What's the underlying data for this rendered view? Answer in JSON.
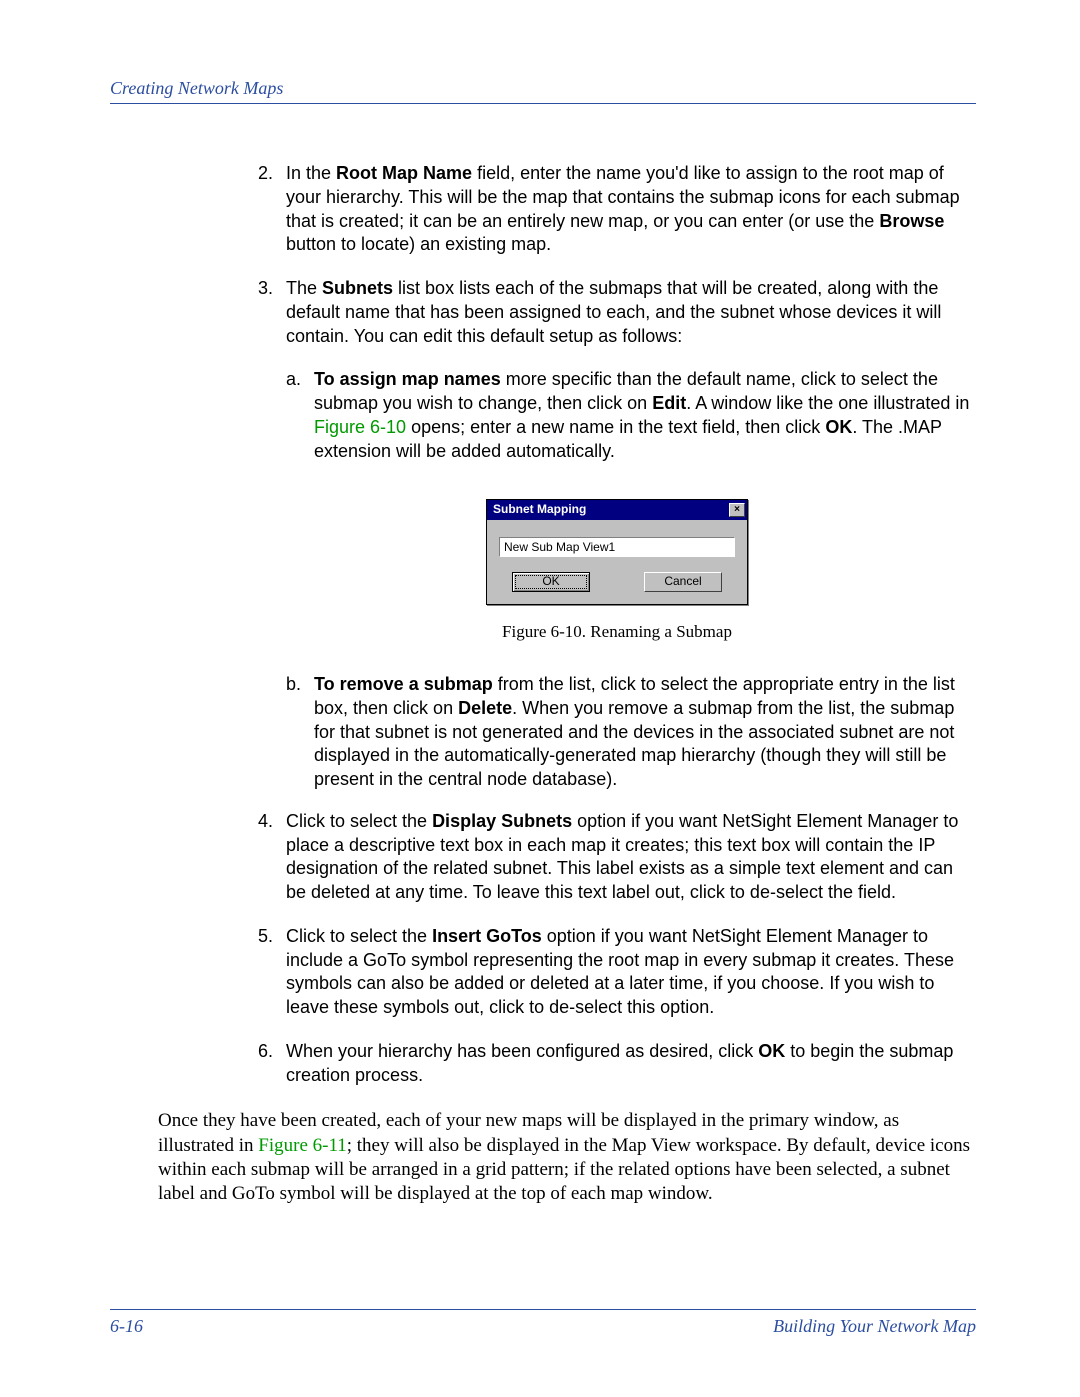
{
  "header": {
    "title": "Creating Network Maps"
  },
  "steps": {
    "s2": {
      "num": "2.",
      "t0": "In the ",
      "b0": "Root Map Name",
      "t1": " field, enter the name you'd like to assign to the root map of your hierarchy. This will be the map that contains the submap icons for each submap that is created; it can be an entirely new map, or you can enter (or use the ",
      "b1": "Browse",
      "t2": " button to locate) an existing map."
    },
    "s3": {
      "num": "3.",
      "t0": "The ",
      "b0": "Subnets",
      "t1": " list box lists each of the submaps that will be created, along with the default name that has been assigned to each, and the subnet whose devices it will contain. You can edit this default setup as follows:"
    },
    "s3a": {
      "letter": "a.",
      "b0": "To assign map names",
      "t0": " more specific than the default name, click to select the submap you wish to change, then click on ",
      "b1": "Edit",
      "t1": ". A window like the one illustrated in ",
      "ref": "Figure 6-10",
      "t2": " opens; enter a new name in the text field, then click ",
      "b2": "OK",
      "t3": ". The .MAP extension will be added automatically."
    },
    "s3b": {
      "letter": "b.",
      "b0": "To remove a submap",
      "t0": " from the list, click to select the appropriate entry in the list box, then click on ",
      "b1": "Delete",
      "t1": ". When you remove a submap from the list, the submap for that subnet is not generated and the devices in the associated subnet are not displayed in the automatically-generated map hierarchy (though they will still be present in the central node database)."
    },
    "s4": {
      "num": "4.",
      "t0": "Click to select the ",
      "b0": "Display Subnets",
      "t1": " option if you want NetSight Element Manager to place a descriptive text box in each map it creates; this text box will contain the IP designation of the related subnet. This label exists as a simple text element and can be deleted at any time. To leave this text label out, click to de-select the field."
    },
    "s5": {
      "num": "5.",
      "t0": "Click to select the ",
      "b0": "Insert GoTos",
      "t1": " option if you want NetSight Element Manager to include a GoTo symbol representing the root map in every submap it creates. These symbols can also be added or deleted at a later time, if you choose. If you wish to leave these symbols out, click to de-select this option."
    },
    "s6": {
      "num": "6.",
      "t0": "When your hierarchy has been configured as desired, click ",
      "b0": "OK",
      "t1": " to begin the submap creation process."
    }
  },
  "dialog": {
    "title": "Subnet Mapping",
    "close": "×",
    "input": "New Sub Map View1",
    "ok": "OK",
    "cancel": "Cancel"
  },
  "caption": "Figure 6-10.  Renaming a Submap",
  "closing": {
    "t0": "Once they have been created, each of your new maps will be displayed in the primary window, as illustrated in ",
    "ref": "Figure 6-11",
    "t1": "; they will also be displayed in the Map View workspace. By default, device icons within each submap will be arranged in a grid pattern; if the related options have been selected, a subnet label and GoTo symbol will be displayed at the top of each map window."
  },
  "footer": {
    "page": "6-16",
    "section": "Building Your Network Map"
  }
}
